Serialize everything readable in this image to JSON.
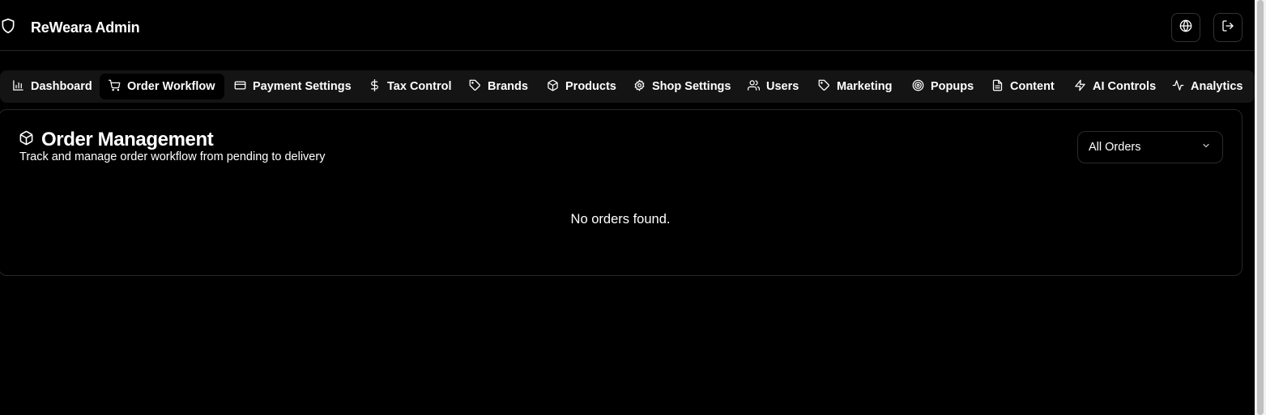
{
  "header": {
    "title": "ReWeara Admin",
    "icons": {
      "logo": "shield-icon",
      "language": "globe-icon",
      "logout": "log-out-icon"
    }
  },
  "tabs": [
    {
      "label": "Dashboard",
      "icon": "bar-chart-icon",
      "active": false
    },
    {
      "label": "Order Workflow",
      "icon": "shopping-cart-icon",
      "active": true
    },
    {
      "label": "Payment Settings",
      "icon": "credit-card-icon",
      "active": false
    },
    {
      "label": "Tax Control",
      "icon": "dollar-sign-icon",
      "active": false
    },
    {
      "label": "Brands",
      "icon": "tag-icon",
      "active": false
    },
    {
      "label": "Products",
      "icon": "package-icon",
      "active": false
    },
    {
      "label": "Shop Settings",
      "icon": "settings-icon",
      "active": false
    },
    {
      "label": "Users",
      "icon": "users-icon",
      "active": false
    },
    {
      "label": "Marketing",
      "icon": "tag-icon",
      "active": false
    },
    {
      "label": "Popups",
      "icon": "target-icon",
      "active": false
    },
    {
      "label": "Content",
      "icon": "file-text-icon",
      "active": false
    },
    {
      "label": "AI Controls",
      "icon": "zap-icon",
      "active": false
    },
    {
      "label": "Analytics",
      "icon": "activity-icon",
      "active": false
    }
  ],
  "orders": {
    "title": "Order Management",
    "subtitle": "Track and manage order workflow from pending to delivery",
    "title_icon": "package-icon",
    "filter": {
      "selected": "All Orders",
      "icon": "chevron-down-icon"
    },
    "empty_message": "No orders found."
  },
  "colors": {
    "background": "#000000",
    "text": "#ffffff",
    "tabbar": "#141414",
    "border": "#262626"
  }
}
